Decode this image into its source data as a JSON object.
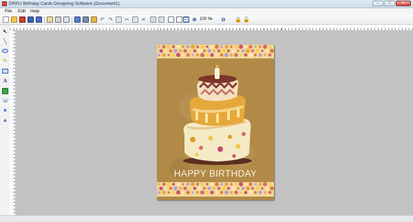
{
  "window": {
    "title": "DRPU Birthday Cards Designing Software  (Document1)",
    "controls": {
      "minimize": "–",
      "maximize": "□",
      "close": "✕"
    }
  },
  "menu": {
    "items": [
      "File",
      "Edit",
      "Help"
    ]
  },
  "toolbar": {
    "zoom_value": "100 %",
    "zoom_dropdown": "▾",
    "icons": [
      "new-icon",
      "open-icon",
      "close-doc-icon",
      "save-icon",
      "save-as-icon",
      "properties-icon",
      "print-icon",
      "print-preview-icon",
      "export-icon",
      "export-image-icon",
      "open-image-icon",
      "undo-icon",
      "redo-icon",
      "copy-icon",
      "cut-icon",
      "paste-icon",
      "delete-icon",
      "copy-object-icon",
      "paste-object-icon",
      "align-icon",
      "fit-window-icon",
      "grid-icon",
      "zoom-in-icon",
      "zoom-out-icon",
      "lock-icon",
      "unlock-icon"
    ]
  },
  "sidebar": {
    "tools": [
      "pointer-tool-icon",
      "line-tool-icon",
      "ellipse-tool-icon",
      "pencil-tool-icon",
      "rectangle-tool-icon",
      "text-tool-icon",
      "image-tool-icon",
      "phone-tool-icon",
      "star-tool-icon",
      "triangle-tool-icon"
    ]
  },
  "card": {
    "text": "HAPPY BIRTHDAY",
    "colors": {
      "background": "#b28a47",
      "band": "#f2d79a",
      "text": "#fbf3dc",
      "cake_base": "#f4e9c4",
      "cake_accent": "#e6a83a"
    }
  }
}
